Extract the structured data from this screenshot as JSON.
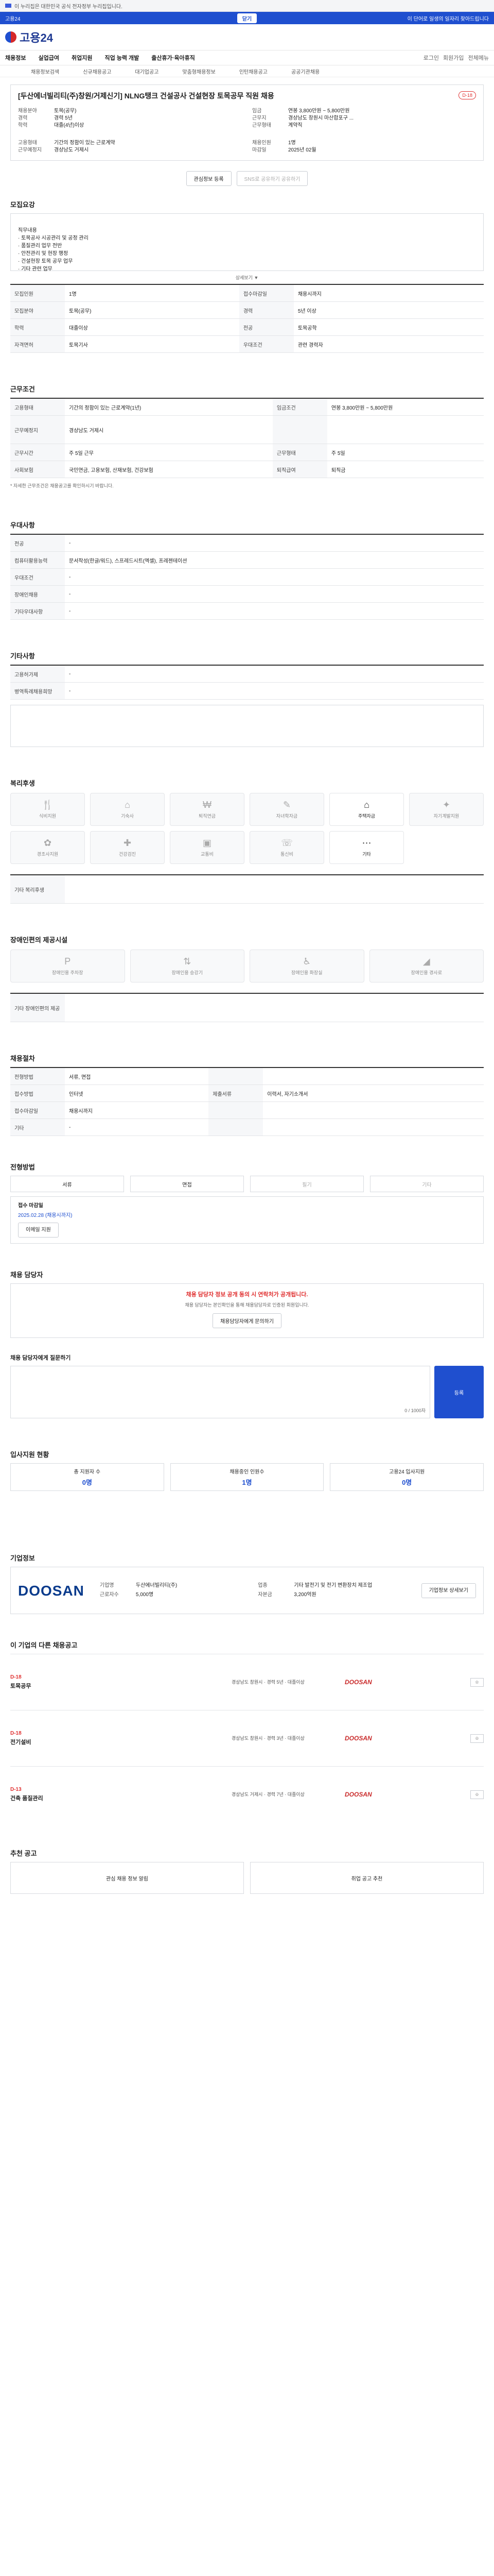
{
  "top": {
    "notice": "이 누리집은 대한민국 공식 전자정부 누리집입니다.",
    "alert_left": "고용24",
    "alert_btn": "닫기",
    "alert_right": "이 단어로 일생의 일자리 찾아드립니다"
  },
  "header": {
    "logo": "고용24",
    "nav": [
      "채용정보",
      "실업급여",
      "취업지원",
      "직업 능력 개발",
      "출산휴가·육아휴직"
    ],
    "nav_right": [
      "로그인",
      "회원가입",
      "전체메뉴"
    ],
    "subnav": [
      "채용정보검색",
      "신규채용공고",
      "대기업공고",
      "맞춤형채용정보",
      "인턴채용공고",
      "공공기관채용"
    ]
  },
  "job": {
    "title": "[두산에너빌리티(주)창원/거제신기] NLNG탱크 건설공사 건설현장 토목공무 직원 채용",
    "badge": "D-18",
    "info_left": [
      {
        "k": "채용분야",
        "v": "토목(공무)"
      },
      {
        "k": "경력",
        "v": "경력 5년"
      },
      {
        "k": "학력",
        "v": "대졸(4년)이상"
      }
    ],
    "info_right": [
      {
        "k": "임금",
        "v": "연봉 3,800만원 ~ 5,800만원"
      },
      {
        "k": "근무지",
        "v": "경상남도 창원시 마산합포구 ..."
      },
      {
        "k": "근무형태",
        "v": "계약직"
      }
    ],
    "cond_left": [
      {
        "k": "고용형태",
        "v": "기간의 정함이 있는 근로계약"
      },
      {
        "k": "근무예정지",
        "v": "경상남도 거제시"
      }
    ],
    "cond_right": [
      {
        "k": "채용인원",
        "v": "1명"
      },
      {
        "k": "마감일",
        "v": "2025년 02월"
      }
    ],
    "btn_save": "관심정보 등록",
    "btn_share": "SNS로 공유하기 공유하기"
  },
  "sections": {
    "recruit": "모집요강",
    "duty_text": "직무내용\n· 토목공사 시공관리 및 공정 관리\n· 품질관리 업무 전반\n· 안전관리 및 현장 행정\n· 건설현장 토목 공무 업무\n· 기타 관련 업무",
    "detail": "상세보기 ▼",
    "table1": [
      {
        "k": "모집인원",
        "v": "1명",
        "k2": "접수마감일",
        "v2": "채용시까지"
      },
      {
        "k": "모집분야",
        "v": "토목(공무)",
        "k2": "경력",
        "v2": "5년 이상"
      },
      {
        "k": "학력",
        "v": "대졸이상",
        "k2": "전공",
        "v2": "토목공학"
      },
      {
        "k": "자격면허",
        "v": "토목기사",
        "k2": "우대조건",
        "v2": "관련 경력자"
      }
    ],
    "work": "근무조건",
    "table2": [
      {
        "k": "고용형태",
        "v": "기간의 정함이 있는 근로계약(1년)",
        "k2": "임금조건",
        "v2": "연봉 3,800만원 ~ 5,800만원"
      },
      {
        "k": "근무예정지",
        "v": "경상남도 거제시",
        "k2": "",
        "v2": ""
      },
      {
        "k": "근무시간",
        "v": "주 5일 근무",
        "k2": "근무형태",
        "v2": "주 5일"
      },
      {
        "k": "사회보험",
        "v": "국민연금, 고용보험, 산재보험, 건강보험",
        "k2": "퇴직급여",
        "v2": "퇴직금"
      }
    ],
    "work_note": "* 자세한 근무조건은 채용공고를 확인하시기 바랍니다.",
    "prefer": "우대사항",
    "table3": [
      {
        "k": "전공",
        "v": "-"
      },
      {
        "k": "컴퓨터활용능력",
        "v": "문서작성(한글/워드), 스프레드시트(엑셀), 프레젠테이션"
      },
      {
        "k": "우대조건",
        "v": "-"
      },
      {
        "k": "장애인채용",
        "v": "-"
      },
      {
        "k": "기타우대사항",
        "v": "-"
      }
    ],
    "etc": "기타사항",
    "table4": [
      {
        "k": "고용허가제",
        "v": "-"
      },
      {
        "k": "병역특례채용희망",
        "v": "-"
      }
    ],
    "welfare": "복리후생",
    "welfare_items": [
      "식비지원",
      "기숙사",
      "퇴직연금",
      "자녀학자금",
      "주택자금",
      "자기계발지원",
      "경조사지원",
      "건강검진",
      "교통비",
      "통신비",
      "기타"
    ],
    "welfare_note_k": "기타 복리후생",
    "disabled": "장애인편의 제공시설",
    "disabled_items": [
      "장애인용 주차장",
      "장애인용 승강기",
      "장애인용 화장실",
      "장애인용 경사로"
    ],
    "disabled_note_k": "기타 장애인편의 제공",
    "process": "채용절차",
    "table5": [
      {
        "k": "전형방법",
        "v": "서류, 면접",
        "k2": "",
        "v2": ""
      },
      {
        "k": "접수방법",
        "v": "인터넷",
        "k2": "제출서류",
        "v2": "이력서, 자기소개서"
      },
      {
        "k": "접수마감일",
        "v": "채용시까지",
        "k2": "",
        "v2": ""
      },
      {
        "k": "기타",
        "v": "-",
        "k2": "",
        "v2": ""
      }
    ],
    "contact": "전형방법",
    "contact_tabs": [
      "서류",
      "면접",
      "필기",
      "기타"
    ],
    "contact_phone_k": "접수 마감일",
    "contact_phone_v": "2025.02.28 (채용시까지)",
    "contact_btn": "이메일 지원",
    "apply": "채용 담당자",
    "apply_notice": "채용 담당자 정보 공개 동의 시 연락처가 공개됩니다.",
    "apply_sub": "채용 담당자는 본인확인을 통해 채용담당자로 인증된 회원입니다.",
    "apply_btn": "채용담당자에게 문의하기",
    "inquiry": "채용 담당자에게 질문하기",
    "inquiry_btn": "등록",
    "inquiry_counter": "0 / 1000자",
    "stats": "입사지원 현황",
    "stat_cards": [
      {
        "k": "총 지원자 수",
        "v": "0명"
      },
      {
        "k": "채용중인 인원수",
        "v": "1명"
      },
      {
        "k": "고용24 입사지원",
        "v": "0명"
      }
    ],
    "company": "기업정보",
    "company_name": "두산에너빌리티(주)",
    "company_info": [
      {
        "k": "기업명",
        "v": "두산에너빌리티(주)"
      },
      {
        "k": "업종",
        "v": "기타 발전기 및 전기 변환장치 제조업"
      },
      {
        "k": "근로자수",
        "v": "5,000명"
      },
      {
        "k": "자본금",
        "v": "3,200억원"
      }
    ],
    "company_btn": "기업정보 상세보기",
    "similar": "이 기업의 다른 채용공고",
    "listings": [
      {
        "d": "D-18",
        "name": "토목공무",
        "mid": "경상남도 창원시 · 경력 5년 · 대졸이상",
        "brand": "DOOSAN"
      },
      {
        "d": "D-18",
        "name": "전기설비",
        "mid": "경상남도 창원시 · 경력 3년 · 대졸이상",
        "brand": "DOOSAN"
      },
      {
        "d": "D-13",
        "name": "건축 품질관리",
        "mid": "경상남도 거제시 · 경력 7년 · 대졸이상",
        "brand": "DOOSAN"
      }
    ],
    "recommend": "추천 공고",
    "rec_items": [
      "관심 채용 정보 알림",
      "취업 공고 추천"
    ]
  }
}
